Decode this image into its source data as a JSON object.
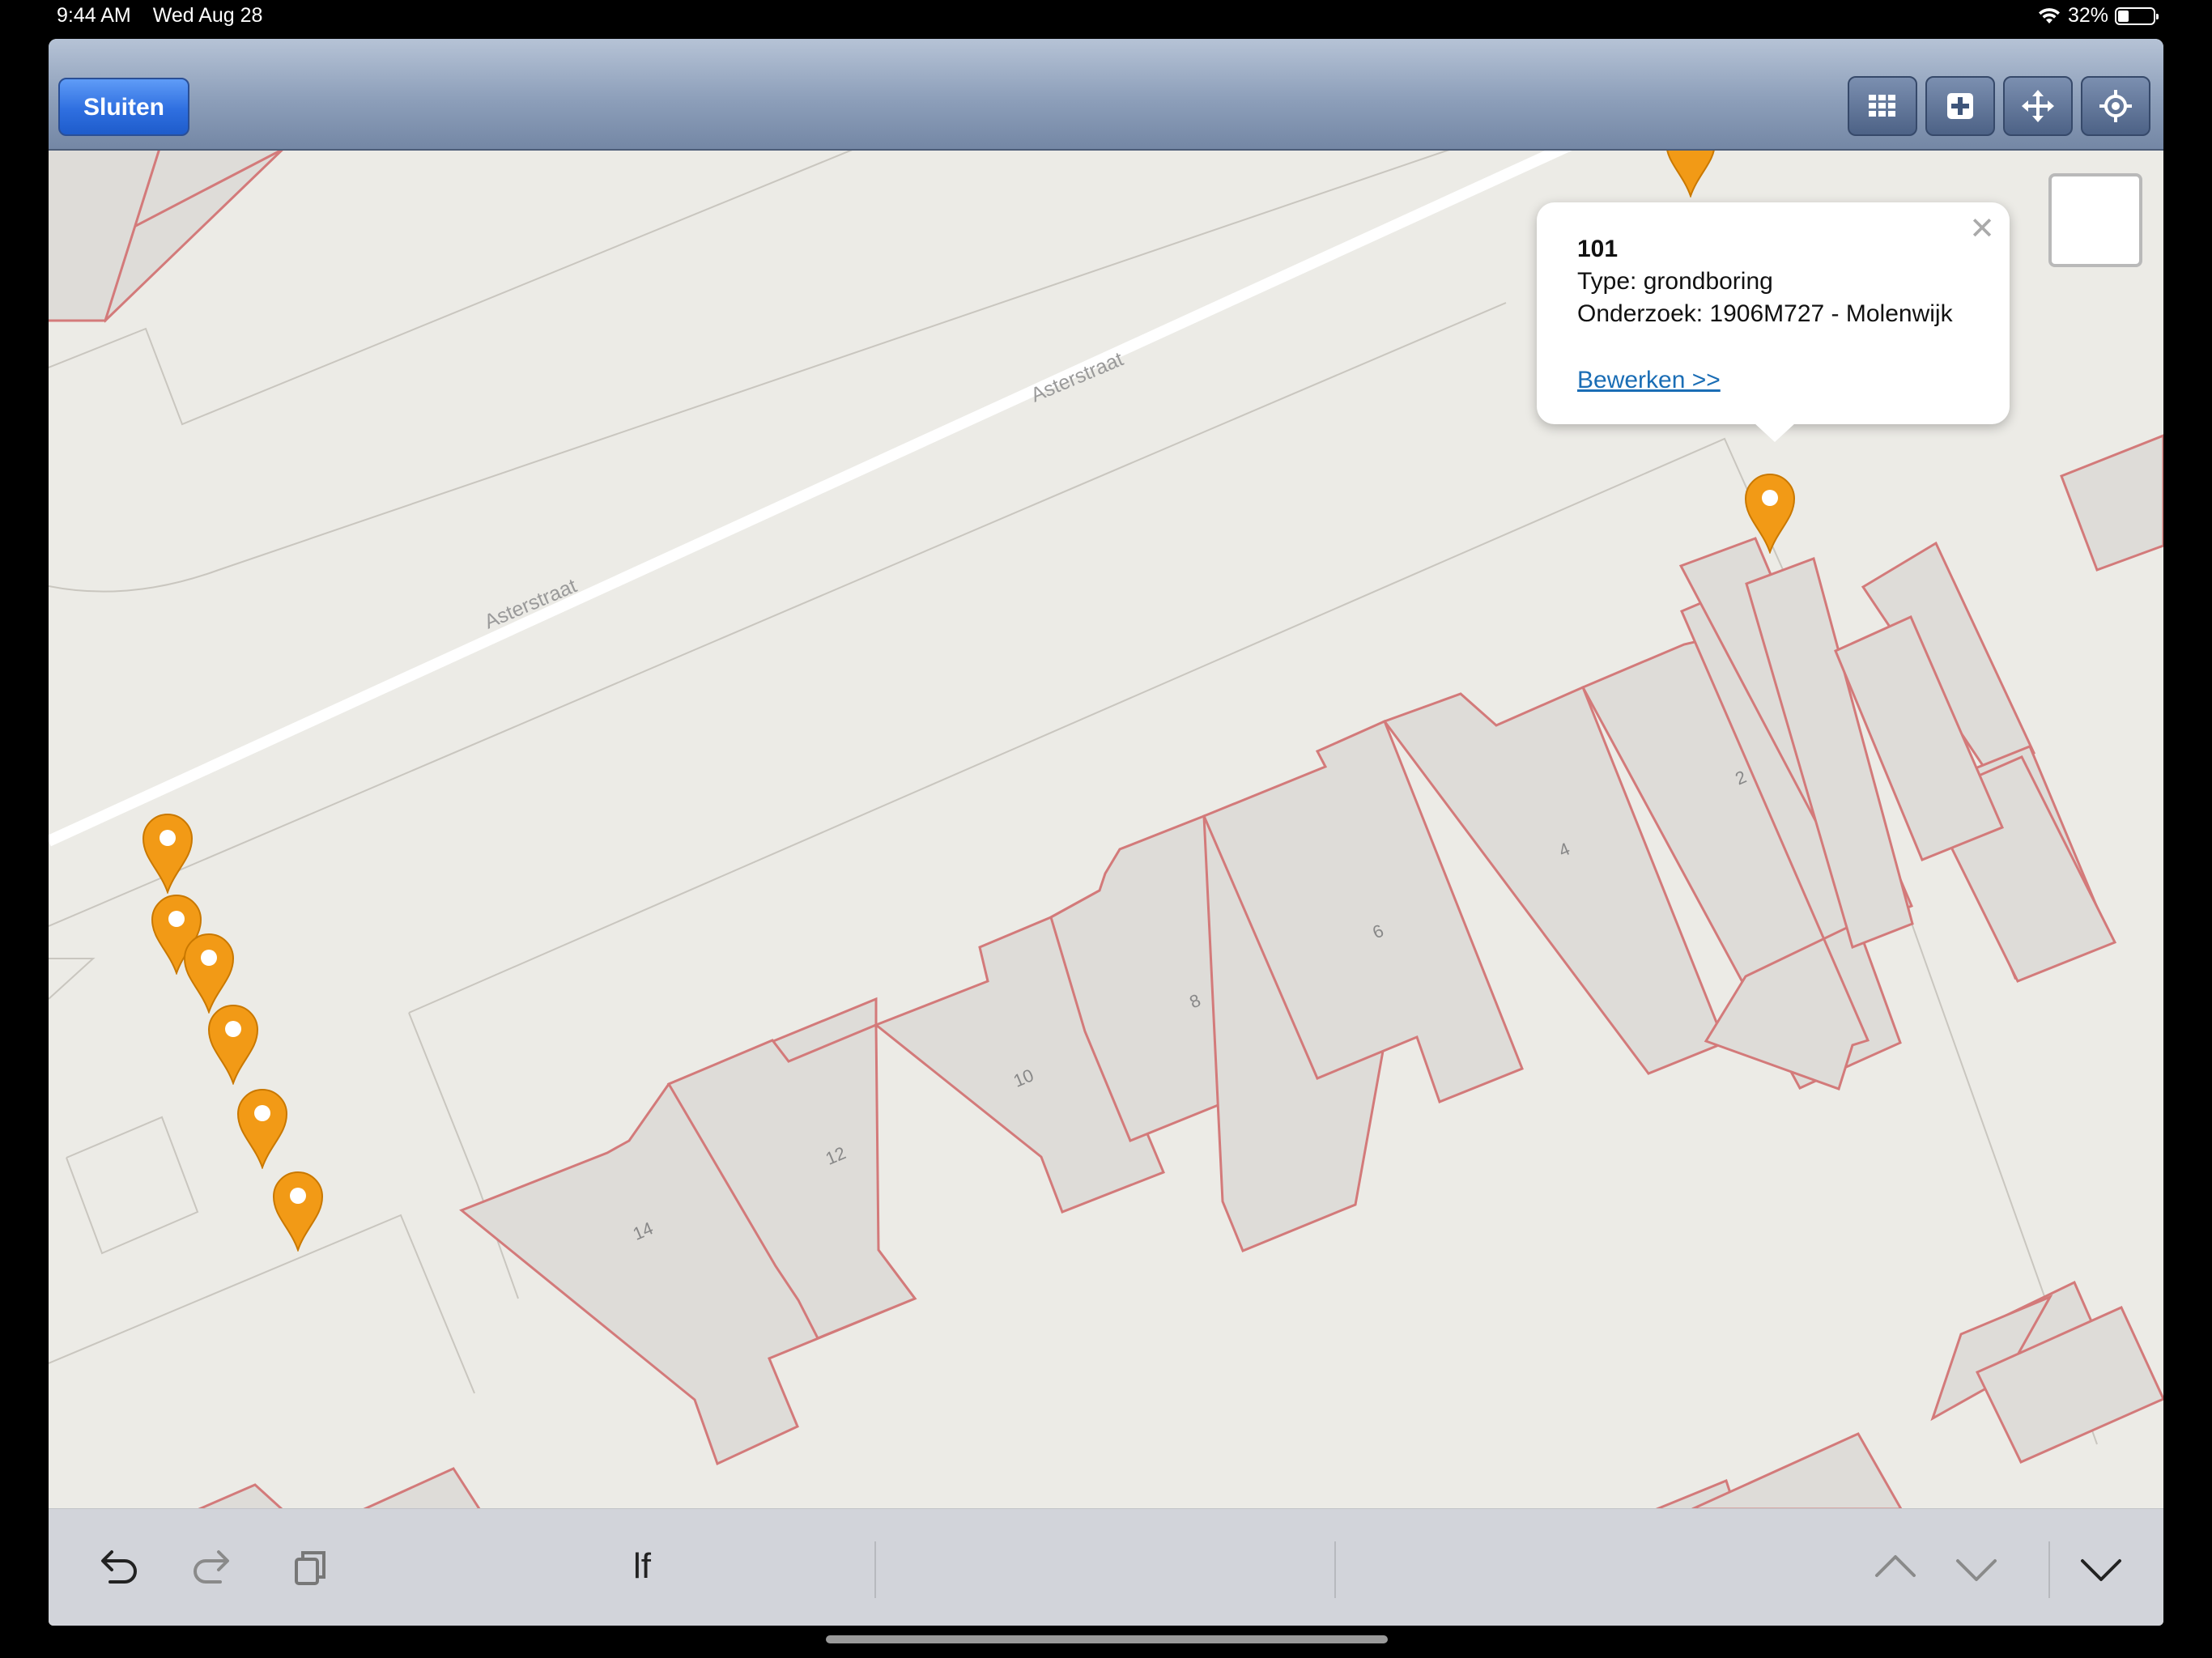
{
  "status_bar": {
    "time": "9:44 AM",
    "date": "Wed Aug 28",
    "battery": "32%",
    "battery_level": 0.32
  },
  "toolbar": {
    "close_label": "Sluiten",
    "tools": [
      "grid-icon",
      "add-icon",
      "move-icon",
      "locate-icon"
    ]
  },
  "map": {
    "street_names": [
      "Asterstraat",
      "Asterstraat"
    ],
    "house_numbers": [
      "2",
      "4",
      "6",
      "8",
      "10",
      "12",
      "14"
    ]
  },
  "popup": {
    "title": "101",
    "type_line": "Type: grondboring",
    "onderzoek_line": "Onderzoek: 1906M727 - Molenwijk",
    "edit_link": "Bewerken >>"
  },
  "keyboard_bar": {
    "suggestion": "lf",
    "icons": [
      "undo-icon",
      "redo-icon",
      "clipboard-icon",
      "chevron-up-icon",
      "chevron-down-icon",
      "dismiss-keyboard-icon"
    ]
  },
  "colors": {
    "pin": "#f29a16",
    "parcel_outline": "#d37a7a",
    "nav_button": "#2f6fe0"
  }
}
